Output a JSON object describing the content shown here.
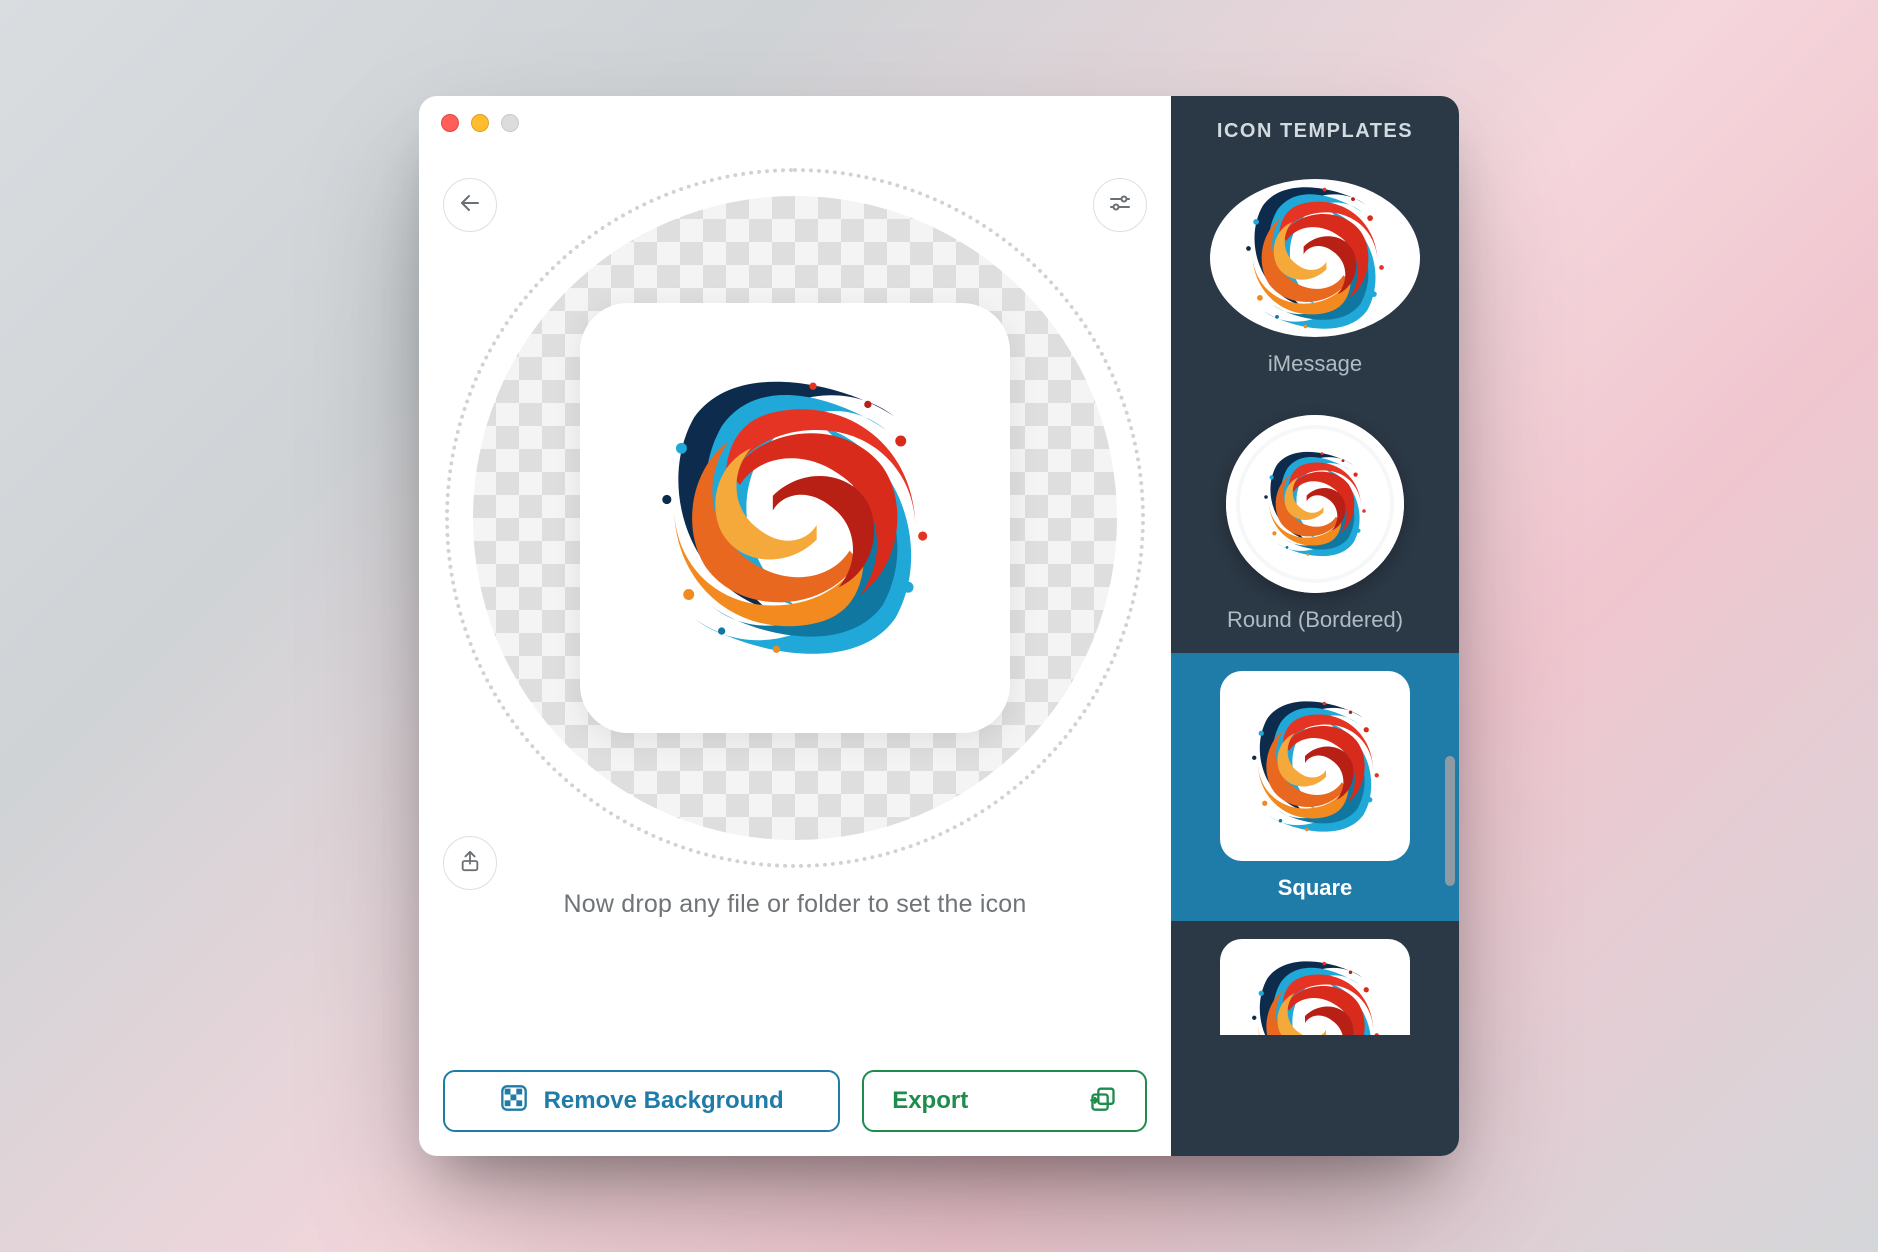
{
  "sidebar": {
    "title": "ICON TEMPLATES",
    "templates": [
      {
        "label": "iMessage"
      },
      {
        "label": "Round (Bordered)"
      },
      {
        "label": "Square"
      }
    ],
    "selected_index": 2
  },
  "main": {
    "hint": "Now drop any file or folder to set the icon",
    "remove_bg_label": "Remove Background",
    "export_label": "Export"
  },
  "colors": {
    "accent_blue": "#1f7ba8",
    "accent_green": "#1f8b4c",
    "sidebar_bg": "#2b3845"
  }
}
